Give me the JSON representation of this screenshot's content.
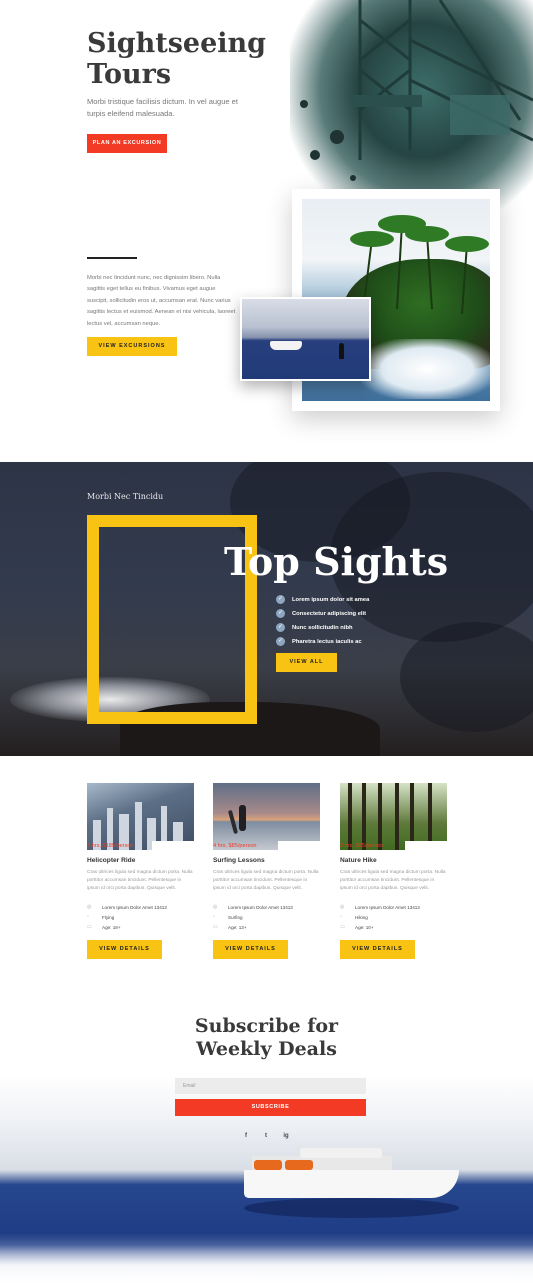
{
  "hero": {
    "title": "Sightseeing\nTours",
    "subtitle": "Morbi tristique facilisis dictum. In vel augue et turpis eleifend malesuada.",
    "cta_label": "PLAN AN EXCURSION"
  },
  "intro": {
    "body": "Morbi nec tincidunt nunc, nec dignissim libero. Nulla sagittis eget tellus eu finibus. Vivamus eget augue suscipit, sollicitudin eros ut, accumsan erat. Nunc varius sagittis lectus et euismod. Aenean et nisi vehicula, laoreet lectus vel, accumsan neque.",
    "cta_label": "VIEW EXCURSIONS"
  },
  "sights": {
    "eyebrow": "Morbi Nec Tincidu",
    "title": "Top Sights",
    "items": [
      "Lorem ipsum dolor sit amea",
      "Consectetur adipiscing elit",
      "Nunc sollicitudin nibh",
      "Pharetra lectus iaculis ac"
    ],
    "cta_label": "VIEW ALL"
  },
  "tours": [
    {
      "price": "2 hrs, $185/person",
      "title": "Helicopter Ride",
      "desc": "Cras ultrices ligula sed magna dictum porta. Nulla porttitor accumsan tincidunt. Pellentesque in ipsum id orci porta dapibus. Quisque velit.",
      "address": "Lorem Ipsum Dolor Amet 13413",
      "category": "Flying",
      "age": "Age: 18+",
      "cta_label": "VIEW DETAILS"
    },
    {
      "price": "4 hrs, $85/person",
      "title": "Surfing Lessons",
      "desc": "Cras ultrices ligula sed magna dictum porta. Nulla porttitor accumsan tincidunt. Pellentesque in ipsum id orci porta dapibus. Quisque velit.",
      "address": "Lorem Ipsum Dolor Amet 13413",
      "category": "Surfing",
      "age": "Age: 13+",
      "cta_label": "VIEW DETAILS"
    },
    {
      "price": "2 hrs, $65/person",
      "title": "Nature Hike",
      "desc": "Cras ultrices ligula sed magna dictum porta. Nulla porttitor accumsan tincidunt. Pellentesque in ipsum id orci porta dapibus. Quisque velit.",
      "address": "Lorem Ipsum Dolor Amet 13413",
      "category": "Hiking",
      "age": "Age: 10+",
      "cta_label": "VIEW DETAILS"
    }
  ],
  "subscribe": {
    "title": "Subscribe for\nWeekly Deals",
    "email_placeholder": "Email",
    "button_label": "SUBSCRIBE",
    "social": [
      "f",
      "t",
      "ig"
    ]
  },
  "icons": {
    "check": "check-icon",
    "location": "map-pin-icon",
    "category": "tag-icon",
    "calendar": "calendar-icon",
    "social": [
      "facebook-icon",
      "twitter-icon",
      "instagram-icon"
    ]
  },
  "colors": {
    "accent_red": "#f23a24",
    "accent_yellow": "#f8c313",
    "dark_section": "#2d3446",
    "text_dark": "#3a3a3a"
  }
}
